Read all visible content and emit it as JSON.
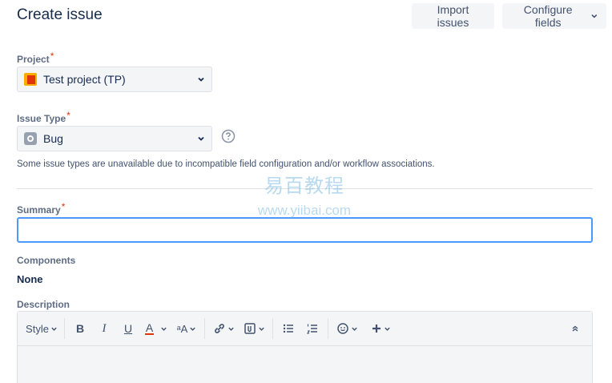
{
  "header": {
    "title": "Create issue",
    "import_label": "Import issues",
    "configure_label": "Configure fields"
  },
  "project": {
    "label": "Project",
    "required_mark": "*",
    "value": "Test project (TP)"
  },
  "issue_type": {
    "label": "Issue Type",
    "required_mark": "*",
    "value": "Bug",
    "helper": "Some issue types are unavailable due to incompatible field configuration and/or workflow associations."
  },
  "summary": {
    "label": "Summary",
    "required_mark": "*",
    "value": ""
  },
  "components": {
    "label": "Components",
    "value": "None"
  },
  "description": {
    "label": "Description",
    "toolbar": {
      "style_label": "Style",
      "bold": "B",
      "italic": "I",
      "underline": "U",
      "color": "A",
      "more_format": "ᵃA"
    }
  },
  "watermark": {
    "cn": "易百教程",
    "url": "www.yiibai.com"
  },
  "colors": {
    "accent": "#4c9aff",
    "required": "#de350b",
    "text_color_underline": "#de350b"
  }
}
